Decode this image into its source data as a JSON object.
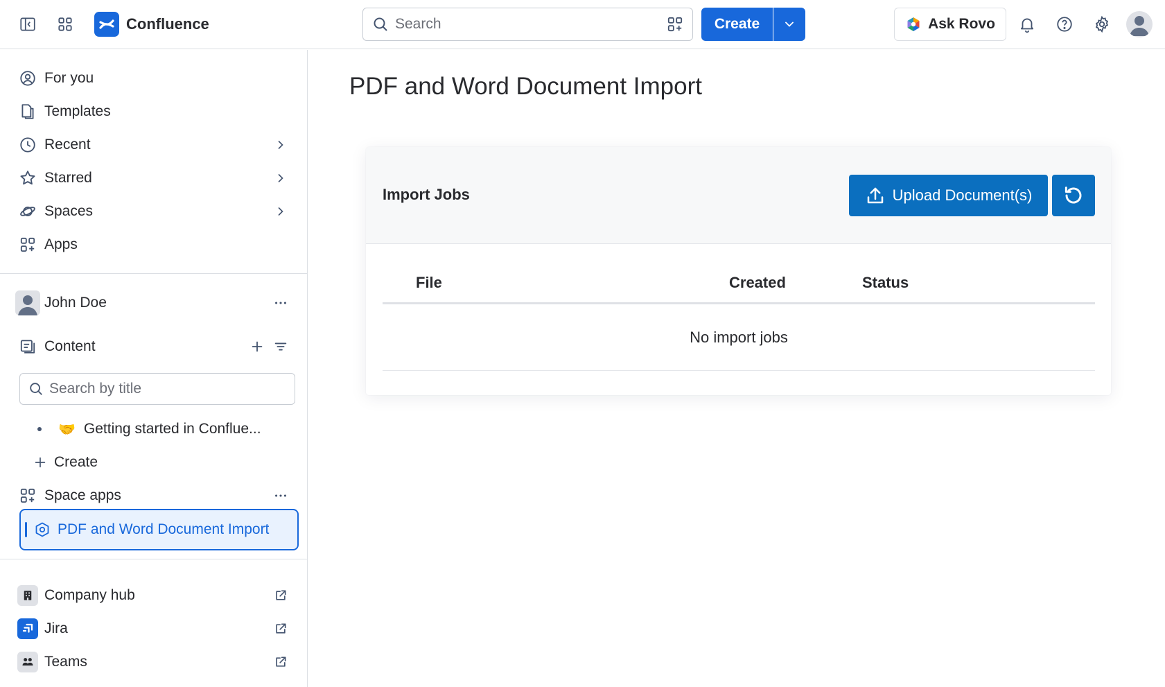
{
  "topbar": {
    "app_name": "Confluence",
    "search_placeholder": "Search",
    "create_label": "Create",
    "rovo_label": "Ask Rovo"
  },
  "sidebar": {
    "nav_items": [
      {
        "label": "For you",
        "icon": "person-circle-icon"
      },
      {
        "label": "Templates",
        "icon": "templates-icon"
      },
      {
        "label": "Recent",
        "icon": "clock-icon"
      },
      {
        "label": "Starred",
        "icon": "star-icon"
      },
      {
        "label": "Spaces",
        "icon": "planet-icon"
      },
      {
        "label": "Apps",
        "icon": "apps-icon"
      }
    ],
    "space": {
      "name": "John Doe",
      "content_label": "Content",
      "search_placeholder": "Search by title",
      "page_item": "Getting started in Conflue...",
      "page_emoji": "🤝",
      "create_label": "Create",
      "space_apps_label": "Space apps",
      "active_app": "PDF and Word Document Import"
    },
    "external": [
      {
        "label": "Company hub",
        "icon": "building-icon"
      },
      {
        "label": "Jira",
        "icon": "jira-icon"
      },
      {
        "label": "Teams",
        "icon": "teams-icon"
      }
    ]
  },
  "main": {
    "page_title": "PDF and Word Document Import",
    "card_title": "Import Jobs",
    "upload_label": "Upload Document(s)",
    "columns": [
      "File",
      "Created",
      "Status"
    ],
    "empty_text": "No import jobs"
  },
  "colors": {
    "brand": "#1868db",
    "upload_button": "#0b6fbf"
  }
}
